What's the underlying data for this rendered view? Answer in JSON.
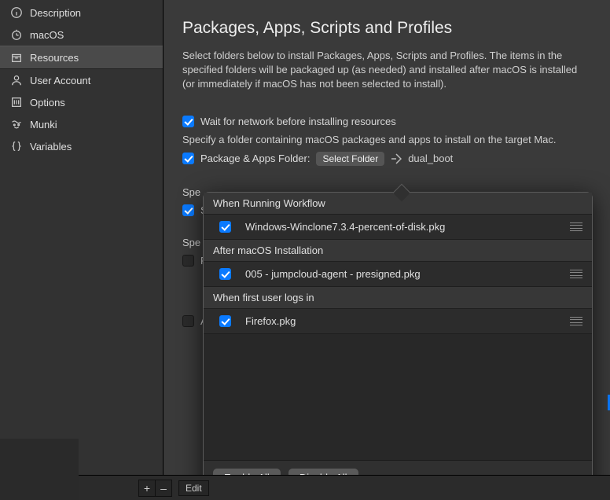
{
  "sidebar": {
    "items": [
      {
        "label": "Description"
      },
      {
        "label": "macOS"
      },
      {
        "label": "Resources"
      },
      {
        "label": "User Account"
      },
      {
        "label": "Options"
      },
      {
        "label": "Munki"
      },
      {
        "label": "Variables"
      }
    ]
  },
  "main": {
    "title": "Packages, Apps, Scripts and Profiles",
    "description": "Select folders below to install Packages, Apps, Scripts and Profiles. The items in the specified folders will be packaged up (as needed) and installed after macOS is installed (or immediately if macOS has not been selected to install).",
    "waitNetworkLabel": "Wait for network before installing resources",
    "packagesIntro": "Specify a folder containing macOS packages and apps to install on the target Mac.",
    "packageFolderLabel": "Package & Apps Folder:",
    "selectFolderBtn": "Select Folder",
    "folderValue": "dual_boot",
    "obscured": {
      "label1": "Spe",
      "chk1": "S",
      "label2": "Spe",
      "chk2": "P",
      "chk3": "A"
    }
  },
  "popover": {
    "groups": [
      {
        "header": "When Running Workflow",
        "items": [
          {
            "label": "Windows-Winclone7.3.4-percent-of-disk.pkg",
            "checked": true
          }
        ]
      },
      {
        "header": "After macOS Installation",
        "items": [
          {
            "label": "005 - jumpcloud-agent - presigned.pkg",
            "checked": true
          }
        ]
      },
      {
        "header": "When first user logs in",
        "items": [
          {
            "label": "Firefox.pkg",
            "checked": true
          }
        ]
      }
    ],
    "enableAll": "Enable All",
    "disableAll": "Disable All"
  },
  "bottom": {
    "plus": "+",
    "minus": "–",
    "edit": "Edit"
  }
}
